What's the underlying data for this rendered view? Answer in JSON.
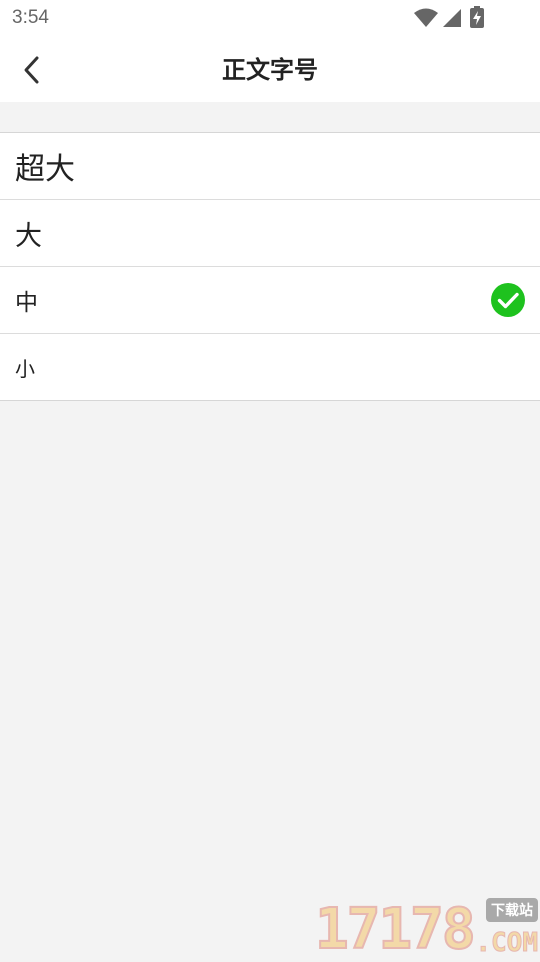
{
  "status_bar": {
    "time": "3:54",
    "icons": [
      "wifi-icon",
      "cellular-signal-icon",
      "battery-charging-icon"
    ]
  },
  "header": {
    "back_icon": "chevron-left-icon",
    "title": "正文字号"
  },
  "options": [
    {
      "label": "超大",
      "selected": false
    },
    {
      "label": "大",
      "selected": false
    },
    {
      "label": "中",
      "selected": true
    },
    {
      "label": "小",
      "selected": false
    }
  ],
  "selected_icon": "check-circle-icon",
  "colors": {
    "accent_green": "#1ec21e",
    "background": "#f3f3f3",
    "surface": "#ffffff",
    "text": "#222222"
  },
  "watermark": {
    "digits": "17178",
    "tag": "下载站",
    "suffix": ".COM"
  }
}
